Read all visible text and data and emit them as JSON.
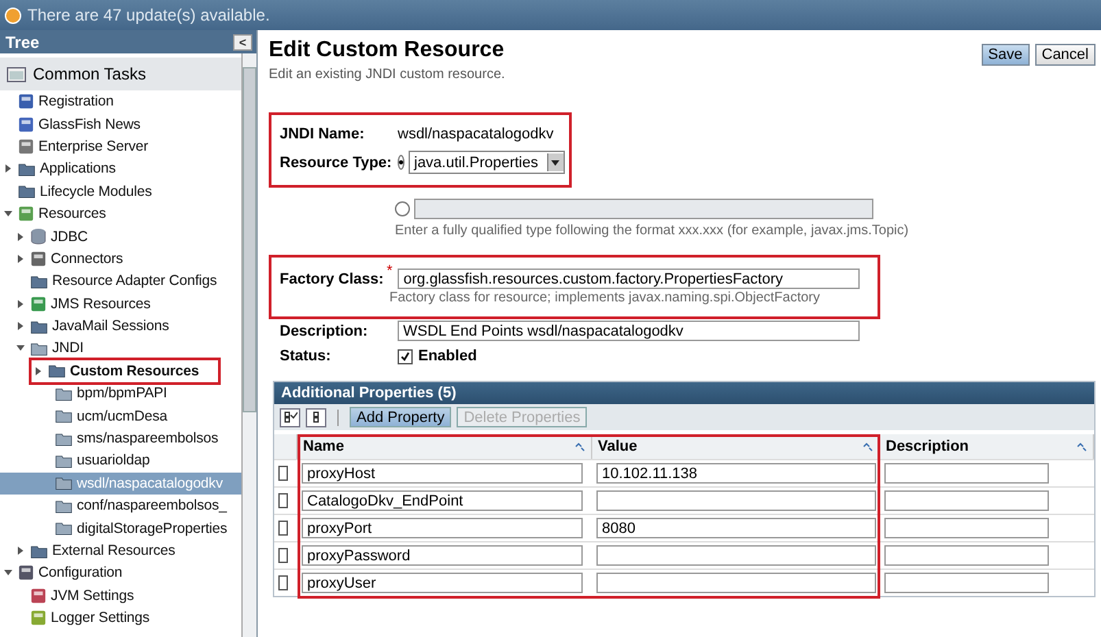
{
  "update_bar": {
    "text": "There are 47 update(s) available."
  },
  "tree": {
    "title": "Tree",
    "collapse_glyph": "<",
    "common_tasks": "Common Tasks",
    "items": [
      {
        "label": "Registration",
        "kind": "registration"
      },
      {
        "label": "GlassFish News",
        "kind": "news"
      },
      {
        "label": "Enterprise Server",
        "kind": "server"
      },
      {
        "label": "Applications",
        "kind": "folder",
        "expanded": false
      },
      {
        "label": "Lifecycle Modules",
        "kind": "folder"
      },
      {
        "label": "Resources",
        "kind": "resources",
        "expanded": true,
        "children": [
          {
            "label": "JDBC",
            "kind": "database",
            "expanded": false
          },
          {
            "label": "Connectors",
            "kind": "connector",
            "expanded": false
          },
          {
            "label": "Resource Adapter Configs",
            "kind": "folder"
          },
          {
            "label": "JMS Resources",
            "kind": "jms",
            "expanded": false
          },
          {
            "label": "JavaMail Sessions",
            "kind": "folder",
            "expanded": false
          },
          {
            "label": "JNDI",
            "kind": "resource",
            "expanded": true,
            "children": [
              {
                "label": "Custom Resources",
                "kind": "folder",
                "expanded": false,
                "highlighted": true,
                "bold": true,
                "children": [
                  {
                    "label": "bpm/bpmPAPI",
                    "kind": "resource",
                    "selected": false
                  },
                  {
                    "label": "ucm/ucmDesa",
                    "kind": "resource",
                    "selected": false
                  },
                  {
                    "label": "sms/naspareembolsos",
                    "kind": "resource",
                    "selected": false
                  },
                  {
                    "label": "usuarioldap",
                    "kind": "resource",
                    "selected": false
                  },
                  {
                    "label": "wsdl/naspacatalogodkv",
                    "kind": "resource",
                    "selected": true
                  },
                  {
                    "label": "conf/naspareembolsos_",
                    "kind": "resource",
                    "selected": false
                  },
                  {
                    "label": "digitalStorageProperties",
                    "kind": "resource",
                    "selected": false
                  }
                ]
              }
            ]
          },
          {
            "label": "External Resources",
            "kind": "folder",
            "expanded": false
          }
        ]
      },
      {
        "label": "Configuration",
        "kind": "config",
        "expanded": true,
        "children": [
          {
            "label": "JVM Settings",
            "kind": "jvm"
          },
          {
            "label": "Logger Settings",
            "kind": "logger"
          }
        ]
      }
    ]
  },
  "page": {
    "title": "Edit Custom Resource",
    "subtitle": "Edit an existing JNDI custom resource.",
    "buttons": [
      {
        "label": "Save",
        "primary": true
      },
      {
        "label": "Cancel",
        "primary": false
      }
    ]
  },
  "form": {
    "jndi_name": {
      "label": "JNDI Name:",
      "value": "wsdl/naspacatalogodkv"
    },
    "resource_type": {
      "label": "Resource Type:",
      "options": [
        {
          "kind": "select",
          "selected": true,
          "value": "java.util.Properties"
        },
        {
          "kind": "text",
          "selected": false,
          "help": "Enter a fully qualified type following the format xxx.xxx (for example, javax.jms.Topic)"
        }
      ]
    },
    "top_highlighted": true,
    "factory_class": {
      "label": "Factory Class:",
      "required_mark": "*",
      "value": "org.glassfish.resources.custom.factory.PropertiesFactory",
      "help": "Factory class for resource; implements javax.naming.spi.ObjectFactory",
      "highlighted": true
    },
    "description": {
      "label": "Description:",
      "value": "WSDL End Points wsdl/naspacatalogodkv"
    },
    "status": {
      "label": "Status:",
      "checkbox_label": "Enabled",
      "checked": true
    }
  },
  "properties": {
    "title": "Additional Properties (5)",
    "toolbar": [
      {
        "label": "Add Property",
        "disabled": false
      },
      {
        "label": "Delete Properties",
        "disabled": true
      }
    ],
    "highlighted": true,
    "columns": [
      "Name",
      "Value",
      "Description"
    ],
    "rows": [
      {
        "checked": false,
        "name": "proxyHost",
        "value": "10.102.11.138"
      },
      {
        "checked": false,
        "name": "CatalogoDkv_EndPoint"
      },
      {
        "checked": false,
        "name": "proxyPort",
        "value": "8080"
      },
      {
        "checked": false,
        "name": "proxyPassword"
      },
      {
        "checked": false,
        "name": "proxyUser"
      }
    ]
  }
}
